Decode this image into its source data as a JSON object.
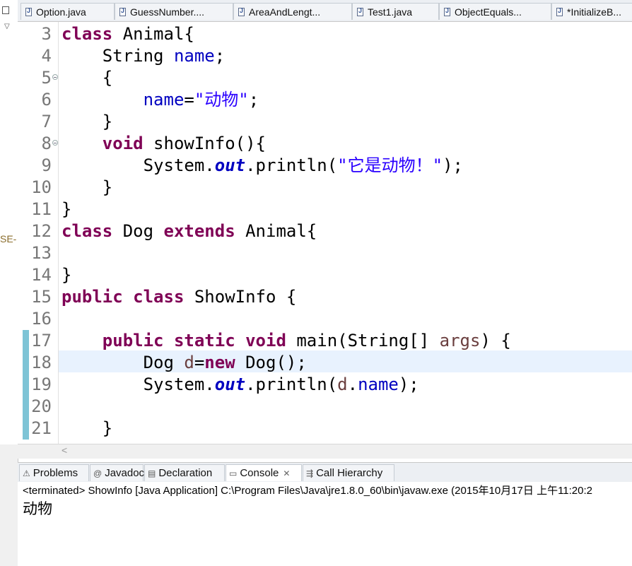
{
  "editor_tabs": [
    {
      "label": "Option.java"
    },
    {
      "label": "GuessNumber...."
    },
    {
      "label": "AreaAndLengt..."
    },
    {
      "label": "Test1.java"
    },
    {
      "label": "ObjectEquals..."
    },
    {
      "label": "*InitializeB..."
    }
  ],
  "left_strip": {
    "truncated_text": "SE-"
  },
  "code_lines": [
    {
      "num": "3",
      "tokens": [
        {
          "t": "class",
          "c": "kw"
        },
        {
          "t": " Animal{",
          "c": ""
        }
      ]
    },
    {
      "num": "4",
      "tokens": [
        {
          "t": "    String ",
          "c": ""
        },
        {
          "t": "name",
          "c": "fld"
        },
        {
          "t": ";",
          "c": ""
        }
      ]
    },
    {
      "num": "5",
      "fold": true,
      "tokens": [
        {
          "t": "    {",
          "c": ""
        }
      ]
    },
    {
      "num": "6",
      "tokens": [
        {
          "t": "        ",
          "c": ""
        },
        {
          "t": "name",
          "c": "fld"
        },
        {
          "t": "=",
          "c": ""
        },
        {
          "t": "\"动物\"",
          "c": "str"
        },
        {
          "t": ";",
          "c": ""
        }
      ]
    },
    {
      "num": "7",
      "tokens": [
        {
          "t": "    }",
          "c": ""
        }
      ]
    },
    {
      "num": "8",
      "fold": true,
      "tokens": [
        {
          "t": "    ",
          "c": ""
        },
        {
          "t": "void",
          "c": "kw"
        },
        {
          "t": " showInfo(){",
          "c": ""
        }
      ]
    },
    {
      "num": "9",
      "tokens": [
        {
          "t": "        System.",
          "c": ""
        },
        {
          "t": "out",
          "c": "sf"
        },
        {
          "t": ".println(",
          "c": ""
        },
        {
          "t": "\"它是动物！\"",
          "c": "str"
        },
        {
          "t": ");",
          "c": ""
        }
      ]
    },
    {
      "num": "10",
      "tokens": [
        {
          "t": "    }",
          "c": ""
        }
      ]
    },
    {
      "num": "11",
      "tokens": [
        {
          "t": "}",
          "c": ""
        }
      ]
    },
    {
      "num": "12",
      "tokens": [
        {
          "t": "class",
          "c": "kw"
        },
        {
          "t": " Dog ",
          "c": ""
        },
        {
          "t": "extends",
          "c": "kw"
        },
        {
          "t": " Animal{",
          "c": ""
        }
      ]
    },
    {
      "num": "13",
      "tokens": []
    },
    {
      "num": "14",
      "tokens": [
        {
          "t": "}",
          "c": ""
        }
      ]
    },
    {
      "num": "15",
      "tokens": [
        {
          "t": "public",
          "c": "kw"
        },
        {
          "t": " ",
          "c": ""
        },
        {
          "t": "class",
          "c": "kw"
        },
        {
          "t": " ShowInfo {",
          "c": ""
        }
      ]
    },
    {
      "num": "16",
      "tokens": []
    },
    {
      "num": "17",
      "mark": true,
      "tokens": [
        {
          "t": "    ",
          "c": ""
        },
        {
          "t": "public",
          "c": "kw"
        },
        {
          "t": " ",
          "c": ""
        },
        {
          "t": "static",
          "c": "kw"
        },
        {
          "t": " ",
          "c": ""
        },
        {
          "t": "void",
          "c": "kw"
        },
        {
          "t": " main(String[] ",
          "c": ""
        },
        {
          "t": "args",
          "c": "par"
        },
        {
          "t": ") {",
          "c": ""
        }
      ]
    },
    {
      "num": "18",
      "mark": true,
      "current": true,
      "tokens": [
        {
          "t": "        Dog ",
          "c": ""
        },
        {
          "t": "d",
          "c": "par"
        },
        {
          "t": "=",
          "c": ""
        },
        {
          "t": "new",
          "c": "kw"
        },
        {
          "t": " Dog();",
          "c": ""
        }
      ]
    },
    {
      "num": "19",
      "mark": true,
      "tokens": [
        {
          "t": "        System.",
          "c": ""
        },
        {
          "t": "out",
          "c": "sf"
        },
        {
          "t": ".println(",
          "c": ""
        },
        {
          "t": "d",
          "c": "par"
        },
        {
          "t": ".",
          "c": ""
        },
        {
          "t": "name",
          "c": "fld"
        },
        {
          "t": ");",
          "c": ""
        }
      ]
    },
    {
      "num": "20",
      "mark": true,
      "tokens": []
    },
    {
      "num": "21",
      "mark": true,
      "tokens": [
        {
          "t": "    }",
          "c": ""
        }
      ]
    }
  ],
  "scroll_hint": "<",
  "view_tabs": [
    {
      "label": "Problems",
      "icon": "problems-icon",
      "glyph": "⚠"
    },
    {
      "label": "Javadoc",
      "icon": "javadoc-icon",
      "glyph": "@"
    },
    {
      "label": "Declaration",
      "icon": "declaration-icon",
      "glyph": "▤"
    },
    {
      "label": "Console",
      "icon": "console-icon",
      "glyph": "▭",
      "active": true,
      "close": "✕"
    },
    {
      "label": "Call Hierarchy",
      "icon": "call-hierarchy-icon",
      "glyph": "⇶"
    }
  ],
  "console": {
    "status": "<terminated> ShowInfo [Java Application] C:\\Program Files\\Java\\jre1.8.0_60\\bin\\javaw.exe (2015年10月17日 上午11:20:2",
    "output": "动物"
  },
  "colors": {
    "keyword": "#7f0055",
    "field": "#0000c0",
    "string": "#2a00ff",
    "parameter": "#6a3e3e",
    "current_line": "#e8f2fe"
  }
}
